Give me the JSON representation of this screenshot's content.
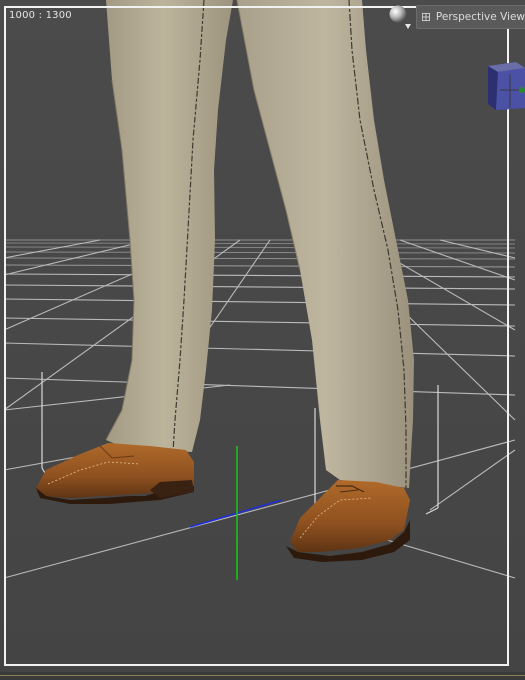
{
  "viewport": {
    "dimensions_label": "1000 : 1300",
    "camera_label": "Perspective View",
    "camera_menu_icon": "grid-view-icon",
    "render_options_icon": "render-sphere-icon",
    "view_cube_icon": "view-cube-icon"
  },
  "scene": {
    "figure": "trousers-and-brown-shoes",
    "axes": {
      "x": "blue",
      "y": "green"
    }
  },
  "colors": {
    "background": "#484848",
    "floor_grid": "#cfcfcf",
    "trousers": "#b3aa93",
    "shoes": "#9a5a22",
    "x_axis": "#1f2fd8",
    "y_axis": "#18c418",
    "frame": "#f2f2f2"
  }
}
